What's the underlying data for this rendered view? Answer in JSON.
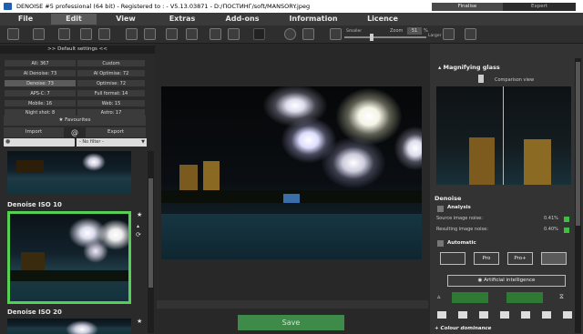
{
  "app": {
    "title": "DENOISE #5 professional (64 bit) - Registered to : - V5.13.03871 - D:/ПОСТИНГ/soft/MANSORY.jpeg",
    "window_buttons": {
      "minimize": "—",
      "maximize": "☐",
      "close": "✕"
    }
  },
  "menu": [
    {
      "label": "File",
      "active": false
    },
    {
      "label": "Edit",
      "active": true
    },
    {
      "label": "View",
      "active": false
    },
    {
      "label": "Extras",
      "active": false
    },
    {
      "label": "Add-ons",
      "active": false
    },
    {
      "label": "Information",
      "active": false
    },
    {
      "label": "Licence",
      "active": false
    }
  ],
  "toolbar": {
    "smaller": "Smaller",
    "zoom_label": "Zoom",
    "zoom_value": "51",
    "zoom_unit": "%",
    "larger": "Larger"
  },
  "left_panel": {
    "default_settings": ">> Default settings <<",
    "presets": [
      [
        "All: 367",
        "Custom"
      ],
      [
        "AI Denoise: 73",
        "AI Optimise: 72"
      ],
      [
        "Denoise: 73",
        "Optimise: 72"
      ],
      [
        "APS-C: 7",
        "Full format: 14"
      ],
      [
        "Mobile: 16",
        "Web: 15"
      ],
      [
        "Night shot: 8",
        "Astro: 17"
      ]
    ],
    "selected_preset": "Denoise: 73",
    "favourites": "Favourites",
    "import": "Import",
    "at": "@",
    "export": "Export",
    "filter": "- No filter -",
    "thumb_labels": [
      "Denoise ISO 10",
      "Denoise ISO 20"
    ]
  },
  "save_label": "Save",
  "right_panel": {
    "tabs": [
      "Finalise",
      "Expert"
    ],
    "active_tab": "Finalise",
    "magnifying_glass": "Magnifying glass",
    "comparison_view": "Comparison view",
    "denoise": "Denoise",
    "analysis": "Analysis",
    "source_noise_label": "Source image noise:",
    "source_noise_value": "0.41%",
    "result_noise_label": "Resulting image noise:",
    "result_noise_value": "0.40%",
    "automatic": "Automatic",
    "modes": [
      "",
      "Pro",
      "Pro+",
      ""
    ],
    "ai_label": "Artificial intelligence",
    "colour_dominance": "Colour dominance"
  },
  "colors": {
    "accent_green": "#3fbf3f",
    "save_green": "#3e8a48",
    "title_bg": "#ffffff",
    "menu_bg": "#3a3a3a"
  }
}
